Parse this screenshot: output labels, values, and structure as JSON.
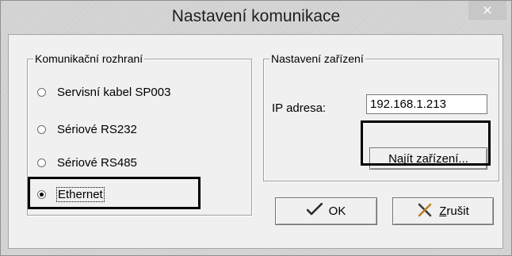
{
  "window": {
    "title": "Nastavení komunikace",
    "close_glyph": "×"
  },
  "interface_group": {
    "label": "Komunikační rozhraní",
    "options": [
      {
        "label": "Servisní kabel SP003",
        "selected": false
      },
      {
        "label": "Sériové RS232",
        "selected": false
      },
      {
        "label": "Sériové RS485",
        "selected": false
      },
      {
        "label": "Ethernet",
        "selected": true
      }
    ]
  },
  "device_group": {
    "label": "Nastavení zařízení",
    "ip_label": "IP adresa:",
    "ip_value": "192.168.1.213",
    "find_button": {
      "prefix": "Najít ",
      "underlined": "z",
      "suffix": "ařízení..."
    }
  },
  "buttons": {
    "ok": {
      "label": "OK",
      "icon": "checkmark-icon"
    },
    "cancel": {
      "label": "Zrušit",
      "underlined": "Z",
      "rest": "rušit",
      "icon": "cross-icon"
    }
  },
  "colors": {
    "ok_check": "#2a2a2a",
    "cancel_cross_dark": "#3a3a3a",
    "cancel_cross_light": "#c08020"
  }
}
